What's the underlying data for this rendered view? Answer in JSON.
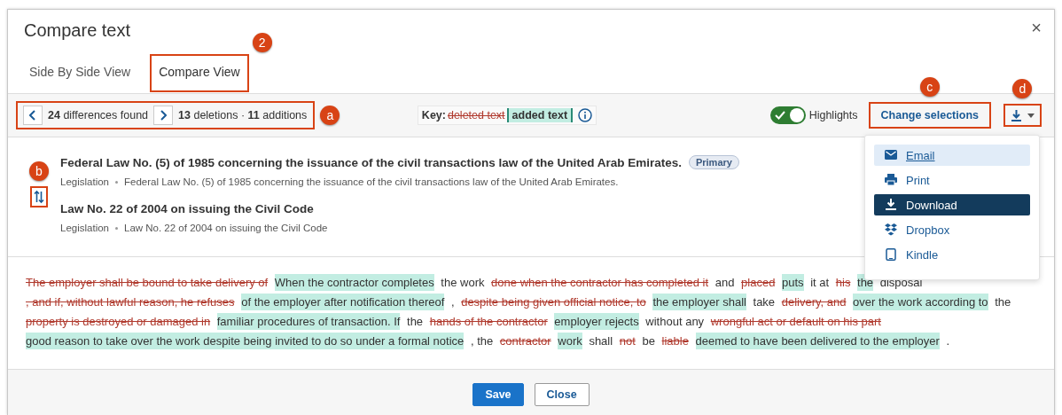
{
  "dialog": {
    "title": "Compare text",
    "close": "×"
  },
  "tabs": [
    {
      "label": "Side By Side View",
      "selected": false
    },
    {
      "label": "Compare View",
      "selected": true,
      "callout": {
        "label": "2"
      }
    }
  ],
  "toolbar": {
    "navigation": {
      "differences_count": "24",
      "differences_label": "differences found",
      "deletions_count": "13",
      "deletions_label": "deletions",
      "separator": "·",
      "additions_count": "11",
      "additions_label": "additions",
      "callout": {
        "label": "a"
      }
    },
    "key": {
      "label": "Key:",
      "deleted": "deleted text",
      "added": "added text"
    },
    "highlights": {
      "label": "Highlights",
      "on": true
    },
    "change_button": {
      "label": "Change selections",
      "callout": {
        "label": "c"
      }
    },
    "download_button": {
      "callout": {
        "label": "d"
      }
    }
  },
  "download_menu": [
    {
      "kind": "email",
      "label": "Email",
      "hovered": true,
      "selected": false
    },
    {
      "kind": "print",
      "label": "Print",
      "hovered": false,
      "selected": false
    },
    {
      "kind": "download",
      "label": "Download",
      "hovered": false,
      "selected": true
    },
    {
      "kind": "dropbox",
      "label": "Dropbox",
      "hovered": false,
      "selected": false
    },
    {
      "kind": "kindle",
      "label": "Kindle",
      "hovered": false,
      "selected": false
    }
  ],
  "documents": {
    "swap_callout": {
      "label": "b"
    },
    "items": [
      {
        "title": "Federal Law No. (5) of 1985 concerning the issuance of the civil transactions law of the United Arab Emirates.",
        "badge": "Primary",
        "type": "Legislation",
        "subtitle": "Federal Law No. (5) of 1985 concerning the issuance of the civil transactions law of the United Arab Emirates."
      },
      {
        "title": "Law No. 22 of 2004 on issuing the Civil Code",
        "type": "Legislation",
        "subtitle": "Law No. 22 of 2004 on issuing the Civil Code"
      }
    ]
  },
  "diff": [
    {
      "kind": "deleted",
      "text": "The employer shall be bound to take delivery of"
    },
    {
      "kind": "added",
      "text": "When the contractor completes"
    },
    {
      "kind": "same",
      "text": "the work"
    },
    {
      "kind": "deleted",
      "text": "done when the contractor has completed it"
    },
    {
      "kind": "same",
      "text": "and"
    },
    {
      "kind": "deleted",
      "text": "placed"
    },
    {
      "kind": "added",
      "text": "puts"
    },
    {
      "kind": "same",
      "text": "it at"
    },
    {
      "kind": "deleted",
      "text": "his"
    },
    {
      "kind": "added",
      "text": "the"
    },
    {
      "kind": "same",
      "text": "disposal"
    },
    {
      "kind": "deleted",
      "text": ", and if, without lawful reason, he refuses"
    },
    {
      "kind": "added",
      "text": "of the employer after notification thereof"
    },
    {
      "kind": "same",
      "text": ","
    },
    {
      "kind": "deleted",
      "text": "despite being given official notice, to"
    },
    {
      "kind": "added",
      "text": "the employer shall"
    },
    {
      "kind": "same",
      "text": "take"
    },
    {
      "kind": "deleted",
      "text": "delivery, and"
    },
    {
      "kind": "added",
      "text": "over the work according to"
    },
    {
      "kind": "same",
      "text": "the"
    },
    {
      "kind": "deleted",
      "text": "property is destroyed or damaged in"
    },
    {
      "kind": "added",
      "text": "familiar procedures of transaction. If"
    },
    {
      "kind": "same",
      "text": "the"
    },
    {
      "kind": "deleted",
      "text": "hands of the contractor"
    },
    {
      "kind": "added",
      "text": "employer rejects"
    },
    {
      "kind": "same",
      "text": "without any"
    },
    {
      "kind": "deleted",
      "text": "wrongful act or default on his part"
    },
    {
      "kind": "added",
      "text": "good reason to take over the work despite being invited to do so under a formal notice"
    },
    {
      "kind": "same",
      "text": ", the"
    },
    {
      "kind": "deleted",
      "text": "contractor"
    },
    {
      "kind": "added",
      "text": "work"
    },
    {
      "kind": "same",
      "text": "shall"
    },
    {
      "kind": "deleted",
      "text": "not"
    },
    {
      "kind": "same",
      "text": "be"
    },
    {
      "kind": "deleted",
      "text": "liable"
    },
    {
      "kind": "added",
      "text": "deemed to have been delivered to the employer"
    },
    {
      "kind": "same",
      "text": "."
    }
  ],
  "footer": {
    "buttons": [
      {
        "label": "Save",
        "kind": "primary"
      },
      {
        "label": "Close",
        "kind": "secondary"
      }
    ]
  }
}
